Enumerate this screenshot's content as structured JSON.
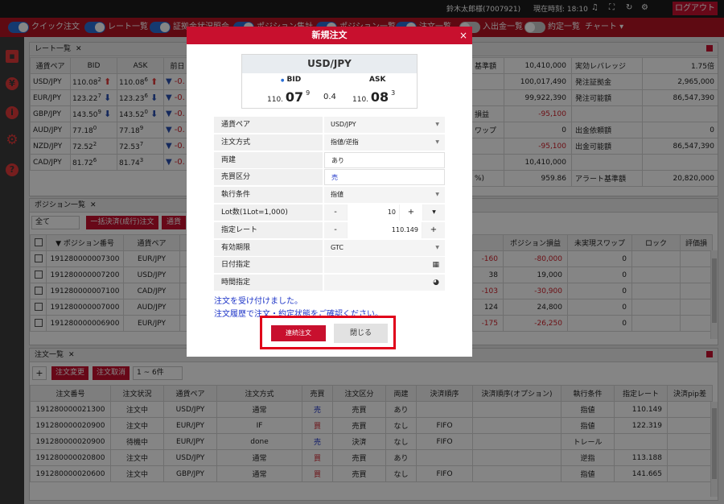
{
  "topbar": {
    "user": "鈴木太郎様(7007921)",
    "clock": "現在時刻: 18:10",
    "logout": "ログアウト"
  },
  "toolbar": {
    "toggles": [
      {
        "label": "クイック注文",
        "on": true
      },
      {
        "label": "レート一覧",
        "on": true
      },
      {
        "label": "証拠金状況照会",
        "on": true
      },
      {
        "label": "ポジション集計",
        "on": true
      },
      {
        "label": "ポジション一覧",
        "on": true
      },
      {
        "label": "注文一覧",
        "on": true
      },
      {
        "label": "入出金一覧",
        "on": false
      },
      {
        "label": "約定一覧",
        "on": false
      }
    ],
    "chart_menu": "チャート"
  },
  "rate_panel": {
    "title": "レート一覧",
    "headers": [
      "通貨ペア",
      "BID",
      "ASK",
      "前日"
    ],
    "rows": [
      {
        "pair": "USD/JPY",
        "bid_main": "110.08",
        "bid_sup": "2",
        "bid_dir": "up",
        "ask_main": "110.08",
        "ask_sup": "6",
        "ask_dir": "up",
        "prev": "-0."
      },
      {
        "pair": "EUR/JPY",
        "bid_main": "123.22",
        "bid_sup": "7",
        "bid_dir": "down",
        "ask_main": "123.23",
        "ask_sup": "6",
        "ask_dir": "down",
        "prev": "-0."
      },
      {
        "pair": "GBP/JPY",
        "bid_main": "143.50",
        "bid_sup": "9",
        "bid_dir": "down",
        "ask_main": "143.52",
        "ask_sup": "0",
        "ask_dir": "down",
        "prev": "-0."
      },
      {
        "pair": "AUD/JPY",
        "bid_main": "77.18",
        "bid_sup": "0",
        "bid_dir": "",
        "ask_main": "77.18",
        "ask_sup": "9",
        "ask_dir": "",
        "prev": "-0."
      },
      {
        "pair": "NZD/JPY",
        "bid_main": "72.52",
        "bid_sup": "2",
        "bid_dir": "",
        "ask_main": "72.53",
        "ask_sup": "7",
        "ask_dir": "",
        "prev": "-0."
      },
      {
        "pair": "CAD/JPY",
        "bid_main": "81.72",
        "bid_sup": "6",
        "bid_dir": "",
        "ask_main": "81.74",
        "ask_sup": "3",
        "ask_dir": "",
        "prev": "-0."
      }
    ]
  },
  "margin_panel": {
    "rows": [
      {
        "l1": "基準額",
        "v1": "10,410,000",
        "l2": "実効レバレッジ",
        "v2": "1.75倍"
      },
      {
        "l1": "",
        "v1": "100,017,490",
        "l2": "発注証拠金",
        "v2": "2,965,000"
      },
      {
        "l1": "",
        "v1": "99,922,390",
        "l2": "発注可能額",
        "v2": "86,547,390"
      },
      {
        "l1": "損益",
        "v1": "-95,100",
        "l2": "",
        "v2": ""
      },
      {
        "l1": "ワップ",
        "v1": "0",
        "l2": "出金依頼額",
        "v2": "0"
      },
      {
        "l1": "",
        "v1": "-95,100",
        "l2": "出金可能額",
        "v2": "86,547,390"
      },
      {
        "l1": "",
        "v1": "10,410,000",
        "l2": "",
        "v2": ""
      },
      {
        "l1": "%)",
        "v1": "959.86",
        "l2": "アラート基準額",
        "v2": "20,820,000"
      }
    ]
  },
  "position_panel": {
    "title": "ポジション一覧",
    "filter": "全て",
    "bulk_button": "一括決済(成行)注文",
    "settle_button": "通貨",
    "headers": [
      "▼ ポジション番号",
      "通貨ペア"
    ],
    "right_headers": [
      "",
      "ポジション損益",
      "未実現スワップ",
      "ロック",
      "評価損"
    ],
    "rows": [
      {
        "id": "191280000007300",
        "pair": "EUR/JPY",
        "pips": "-160",
        "pl": "-80,000",
        "swap": "0"
      },
      {
        "id": "191280000007200",
        "pair": "USD/JPY",
        "pips": "38",
        "pl": "19,000",
        "swap": "0"
      },
      {
        "id": "191280000007100",
        "pair": "CAD/JPY",
        "pips": "-103",
        "pl": "-30,900",
        "swap": "0"
      },
      {
        "id": "191280000007000",
        "pair": "AUD/JPY",
        "pips": "124",
        "pl": "24,800",
        "swap": "0"
      },
      {
        "id": "191280000006900",
        "pair": "EUR/JPY",
        "pips": "-175",
        "pl": "-26,250",
        "swap": "0"
      }
    ]
  },
  "order_panel": {
    "title": "注文一覧",
    "add": "+",
    "change_button": "注文変更",
    "cancel_button": "注文取消",
    "range": "1 ~ 6件",
    "headers": [
      "注文番号",
      "注文状況",
      "通貨ペア",
      "注文方式",
      "売買",
      "注文区分",
      "両建",
      "決済順序",
      "決済順序(オプション)",
      "執行条件",
      "指定レート",
      "決済pip差"
    ],
    "rows": [
      {
        "id": "191280000021300",
        "status": "注文中",
        "pair": "USD/JPY",
        "method": "通常",
        "side": "売",
        "cls": "売買",
        "both": "あり",
        "order": "",
        "opt": "",
        "cond": "指値",
        "rate": "110.149",
        "pip": ""
      },
      {
        "id": "191280000020900",
        "status": "注文中",
        "pair": "EUR/JPY",
        "method": "IF",
        "side": "買",
        "cls": "売買",
        "both": "なし",
        "order": "FIFO",
        "opt": "",
        "cond": "指値",
        "rate": "122.319",
        "pip": ""
      },
      {
        "id": "191280000020900",
        "status": "待機中",
        "pair": "EUR/JPY",
        "method": "done",
        "side": "売",
        "cls": "決済",
        "both": "なし",
        "order": "FIFO",
        "opt": "",
        "cond": "トレール",
        "rate": "",
        "pip": ""
      },
      {
        "id": "191280000020800",
        "status": "注文中",
        "pair": "USD/JPY",
        "method": "通常",
        "side": "買",
        "cls": "売買",
        "both": "あり",
        "order": "",
        "opt": "",
        "cond": "逆指",
        "rate": "113.188",
        "pip": ""
      },
      {
        "id": "191280000020600",
        "status": "注文中",
        "pair": "GBP/JPY",
        "method": "通常",
        "side": "買",
        "cls": "売買",
        "both": "なし",
        "order": "FIFO",
        "opt": "",
        "cond": "指値",
        "rate": "141.665",
        "pip": ""
      }
    ]
  },
  "modal": {
    "title": "新規注文",
    "close": "×",
    "quote": {
      "pair": "USD/JPY",
      "bid_label": "BID",
      "ask_label": "ASK",
      "bid_small": "110.",
      "bid_big": "07",
      "bid_sup": "9",
      "spread": "0.4",
      "ask_small": "110.",
      "ask_big": "08",
      "ask_sup": "3"
    },
    "fields": {
      "pair": {
        "label": "通貨ペア",
        "value": "USD/JPY"
      },
      "method": {
        "label": "注文方式",
        "value": "指値/逆指"
      },
      "both": {
        "label": "両建",
        "value": "あり"
      },
      "side": {
        "label": "売買区分",
        "value": "売"
      },
      "cond": {
        "label": "執行条件",
        "value": "指値"
      },
      "lot": {
        "label": "Lot数(1Lot=1,000)",
        "value": "10"
      },
      "rate": {
        "label": "指定レート",
        "value": "110.149"
      },
      "expiry": {
        "label": "有効期限",
        "value": "GTC"
      },
      "date": {
        "label": "日付指定",
        "value": ""
      },
      "time": {
        "label": "時間指定",
        "value": ""
      }
    },
    "message1": "注文を受け付けました。",
    "message2": "注文履歴で注文・約定状態をご確認ください。",
    "continue_button": "連続注文",
    "close_button": "閉じる"
  }
}
